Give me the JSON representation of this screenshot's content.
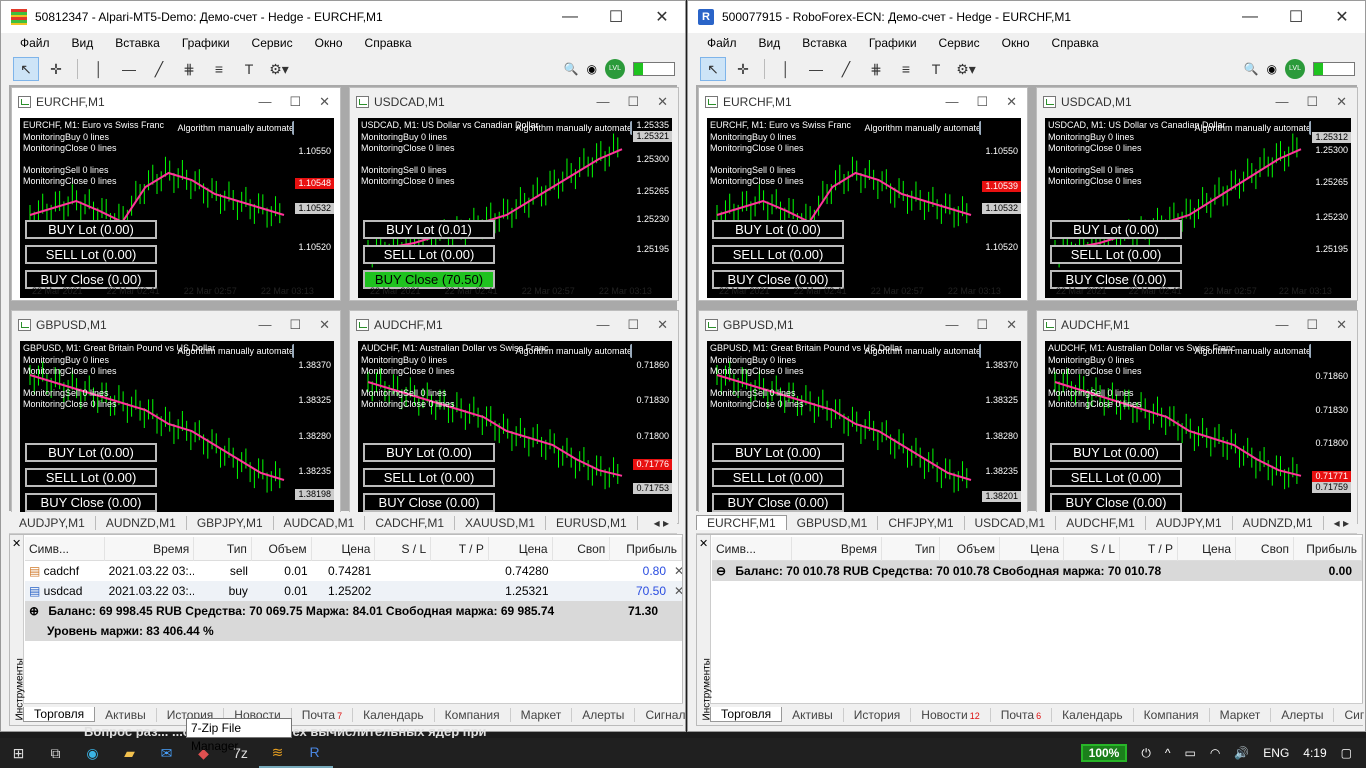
{
  "left": {
    "title": "50812347 - Alpari-MT5-Demo: Демо-счет - Hedge - EURCHF,M1",
    "symbol_tabs": [
      "AUDJPY,M1",
      "AUDNZD,M1",
      "GBPJPY,M1",
      "AUDCAD,M1",
      "CADCHF,M1",
      "XAUUSD,M1",
      "EURUSD,M1"
    ],
    "rows": [
      {
        "symbol": "cadchf",
        "time": "2021.03.22 03:...",
        "type": "sell",
        "volume": "0.01",
        "price": "0.74281",
        "sl": "",
        "tp": "",
        "cur": "0.74280",
        "swap": "",
        "profit": "0.80"
      },
      {
        "symbol": "usdcad",
        "time": "2021.03.22 03:...",
        "type": "buy",
        "volume": "0.01",
        "price": "1.25202",
        "sl": "",
        "tp": "",
        "cur": "1.25321",
        "swap": "",
        "profit": "70.50"
      }
    ],
    "balance_line": "Баланс: 69 998.45 RUB  Средства: 70 069.75  Маржа: 84.01  Свободная маржа: 69 985.74",
    "balance_total": "71.30",
    "margin_level": "Уровень маржи: 83 406.44 %",
    "counts": {
      "mail": "7"
    }
  },
  "right": {
    "title": "500077915 - RoboForex-ECN: Демо-счет - Hedge - EURCHF,M1",
    "symbol_tabs": [
      "EURCHF,M1",
      "GBPUSD,M1",
      "CHFJPY,M1",
      "USDCAD,M1",
      "AUDCHF,M1",
      "AUDJPY,M1",
      "AUDNZD,M1"
    ],
    "balance_line": "Баланс: 70 010.78 RUB  Средства: 70 010.78  Свободная маржа: 70 010.78",
    "balance_total": "0.00",
    "counts": {
      "news": "12",
      "mail": "6"
    }
  },
  "menu": [
    "Файл",
    "Вид",
    "Вставка",
    "Графики",
    "Сервис",
    "Окно",
    "Справка"
  ],
  "columns": {
    "symbol": "Симв...",
    "time": "Время",
    "type": "Тип",
    "volume": "Объем",
    "price": "Цена",
    "sl": "S / L",
    "tp": "T / P",
    "cur": "Цена",
    "swap": "Своп",
    "profit": "Прибыль"
  },
  "bottom_tabs": [
    "Торговля",
    "Активы",
    "История",
    "Новости",
    "Почта",
    "Календарь",
    "Компания",
    "Маркет",
    "Алерты",
    "Сигнал"
  ],
  "side_label": "Инструменты",
  "tooltip": "7-Zip File Manager",
  "bg_text": "Вопрос раз...   ...спользование всех вычислительных ядер при",
  "charts": {
    "eurchf": {
      "title": "EURCHF,M1",
      "desc": "EURCHF, M1:  Euro vs Swiss Franc",
      "y": [
        "1.10550",
        "1.10520"
      ],
      "tag1": "1.10548",
      "tag2": "1.10532",
      "buy": "BUY Lot (0.00)",
      "sell": "SELL Lot (0.00)",
      "close": "BUY Close (0.00)",
      "tag1_r": "1.10539"
    },
    "usdcad": {
      "title": "USDCAD,M1",
      "desc": "USDCAD, M1:  US Dollar vs Canadian Dollar",
      "y": [
        "1.25335",
        "1.25300",
        "1.25265",
        "1.25230",
        "1.25195"
      ],
      "tag1": "1.25321",
      "tag1_r": "1.25312",
      "buy_l": "BUY Lot (0.01)",
      "buy_r": "BUY Lot (0.00)",
      "sell": "SELL Lot (0.00)",
      "close_l": "BUY Close (70.50)",
      "close_r": "BUY Close (0.00)"
    },
    "gbpusd": {
      "title": "GBPUSD,M1",
      "desc": "GBPUSD, M1:  Great Britain Pound vs US Dollar",
      "y": [
        "1.38370",
        "1.38325",
        "1.38280",
        "1.38235"
      ],
      "tag2": "1.38198",
      "tag2_r": "1.38201",
      "buy": "BUY Lot (0.00)",
      "sell": "SELL Lot (0.00)",
      "close": "BUY Close (0.00)"
    },
    "audchf": {
      "title": "AUDCHF,M1",
      "desc": "AUDCHF, M1:  Australian Dollar vs Swiss Franc",
      "y": [
        "0.71860",
        "0.71830",
        "0.71800",
        "0.71770"
      ],
      "tag1": "0.71776",
      "tag2": "0.71753",
      "tag1_r": "0.71771",
      "tag2_r": "0.71759",
      "buy": "BUY Lot (0.00)",
      "sell": "SELL Lot (0.00)",
      "close": "BUY Close (0.00)"
    }
  },
  "chart_common": {
    "auto": "Algorithm manually automate",
    "mon": [
      "MonitoringBuy 0 lines",
      "MonitoringClose 0 lines",
      "",
      "MonitoringSell 0 lines",
      "MonitoringClose 0 lines"
    ],
    "xlabels": [
      "22 Mar 2021",
      "22 Mar 02:41",
      "22 Mar 02:57",
      "22 Mar 03:13"
    ]
  },
  "taskbar": {
    "battery": "100%",
    "lang": "ENG",
    "time": "4:19"
  },
  "colors": {
    "bull": "#00ff00",
    "ma_fast": "#ff3399",
    "ma_slow": "#ff0000",
    "line_cyan": "#33ccff",
    "accent_green": "#1fc21f"
  }
}
